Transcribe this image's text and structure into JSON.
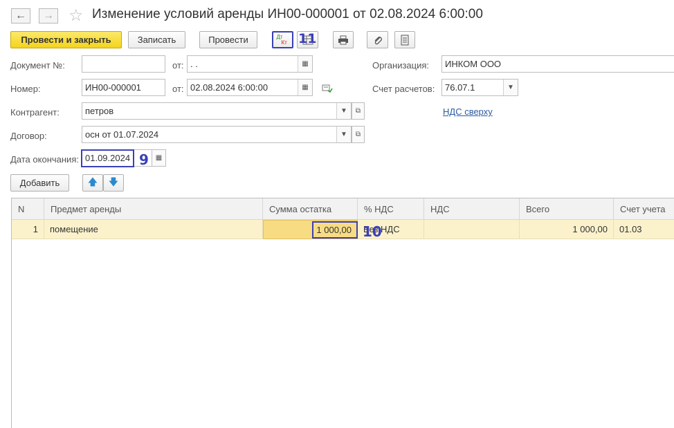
{
  "header": {
    "title": "Изменение условий аренды ИН00-000001 от 02.08.2024 6:00:00"
  },
  "toolbar": {
    "post_close_label": "Провести и закрыть",
    "save_label": "Записать",
    "post_label": "Провести",
    "dtkt_top": "Дт",
    "dtkt_bottom": "Кт"
  },
  "form": {
    "doc_no_label": "Документ №:",
    "doc_no_value": "",
    "from_label": "от:",
    "doc_date_value": " .  .",
    "number_label": "Номер:",
    "number_value": "ИН00-000001",
    "from_label2": "от:",
    "number_date_value": "02.08.2024  6:00:00",
    "counterparty_label": "Контрагент:",
    "counterparty_value": "петров",
    "contract_label": "Договор:",
    "contract_value": "осн от 01.07.2024",
    "end_date_label": "Дата окончания:",
    "end_date_value": "01.09.2024",
    "org_label": "Организация:",
    "org_value": "ИНКОМ ООО",
    "account_label": "Счет расчетов:",
    "account_value": "76.07.1",
    "vat_link": "НДС сверху"
  },
  "table_toolbar": {
    "add_label": "Добавить"
  },
  "table": {
    "columns": [
      "N",
      "Предмет аренды",
      "Сумма остатка",
      "% НДС",
      "НДС",
      "Всего",
      "Счет учета"
    ],
    "rows": [
      {
        "n": "1",
        "subject": "помещение",
        "sum": "1 000,00",
        "vat_rate": "Без НДС",
        "vat": "",
        "total": "1 000,00",
        "account": "01.03"
      }
    ]
  },
  "annotations": {
    "marker_9": "9",
    "marker_10": "10",
    "marker_11": "11"
  }
}
